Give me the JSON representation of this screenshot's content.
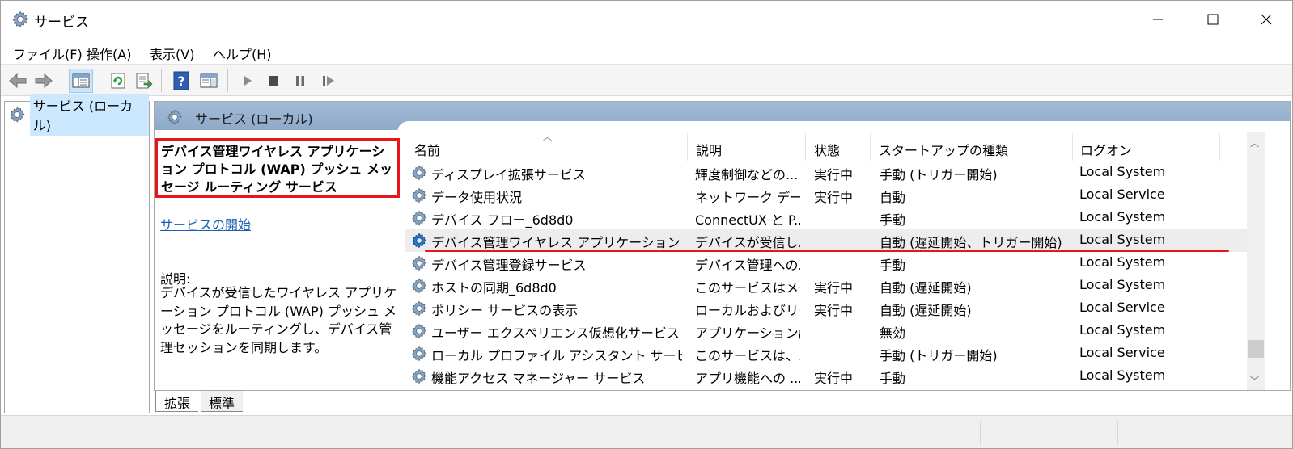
{
  "window": {
    "title": "サービス"
  },
  "menu": [
    "ファイル(F)",
    "操作(A)",
    "表示(V)",
    "ヘルプ(H)"
  ],
  "tree": {
    "item": "サービス (ローカル)"
  },
  "main": {
    "header_title": "サービス (ローカル)",
    "extended": {
      "service_title": "デバイス管理ワイヤレス アプリケーション プロトコル (WAP) プッシュ メッセージ ルーティング サービス",
      "start_link": "サービスの開始",
      "desc_label": "説明:",
      "description": "デバイスが受信したワイヤレス アプリケーション プロトコル (WAP) プッシュ メッセージをルーティングし、デバイス管理セッションを同期します。"
    },
    "columns": [
      "名前",
      "説明",
      "状態",
      "スタートアップの種類",
      "ログオン"
    ],
    "rows": [
      {
        "name": "ディスプレイ拡張サービス",
        "desc": "輝度制御などの...",
        "status": "実行中",
        "startup": "手動 (トリガー開始)",
        "logon": "Local System"
      },
      {
        "name": "データ使用状況",
        "desc": "ネットワーク データ...",
        "status": "実行中",
        "startup": "自動",
        "logon": "Local Service"
      },
      {
        "name": "デバイス フロー_6d8d0",
        "desc": "ConnectUX と P...",
        "status": "",
        "startup": "手動",
        "logon": "Local System"
      },
      {
        "name": "デバイス管理ワイヤレス アプリケーション プロト...",
        "desc": "デバイスが受信し...",
        "status": "",
        "startup": "自動 (遅延開始、トリガー開始)",
        "logon": "Local System"
      },
      {
        "name": "デバイス管理登録サービス",
        "desc": "デバイス管理への...",
        "status": "",
        "startup": "手動",
        "logon": "Local System"
      },
      {
        "name": "ホストの同期_6d8d0",
        "desc": "このサービスはメー...",
        "status": "実行中",
        "startup": "自動 (遅延開始)",
        "logon": "Local System"
      },
      {
        "name": "ポリシー サービスの表示",
        "desc": "ローカルおよびリモ...",
        "status": "実行中",
        "startup": "自動 (遅延開始)",
        "logon": "Local Service"
      },
      {
        "name": "ユーザー エクスペリエンス仮想化サービス",
        "desc": "アプリケーション設...",
        "status": "",
        "startup": "無効",
        "logon": "Local System"
      },
      {
        "name": "ローカル プロファイル アシスタント サービス",
        "desc": "このサービスは、...",
        "status": "",
        "startup": "手動 (トリガー開始)",
        "logon": "Local Service"
      },
      {
        "name": "機能アクセス マネージャー サービス",
        "desc": "アプリ機能への ...",
        "status": "実行中",
        "startup": "手動",
        "logon": "Local System"
      }
    ]
  },
  "tabs": [
    "拡張",
    "標準"
  ],
  "colors": {
    "highlight_red": "#e8141e",
    "header_blue": "#8ea9c8",
    "link_blue": "#1a5fb4",
    "selection_grey": "#ededed"
  },
  "icons": [
    "gear-icon",
    "minimize-icon",
    "maximize-icon",
    "close-icon",
    "back-arrow-icon",
    "forward-arrow-icon",
    "console-tree-icon",
    "refresh-icon",
    "export-list-icon",
    "help-icon",
    "properties-icon",
    "start-service-icon",
    "stop-service-icon",
    "pause-service-icon",
    "restart-service-icon"
  ]
}
